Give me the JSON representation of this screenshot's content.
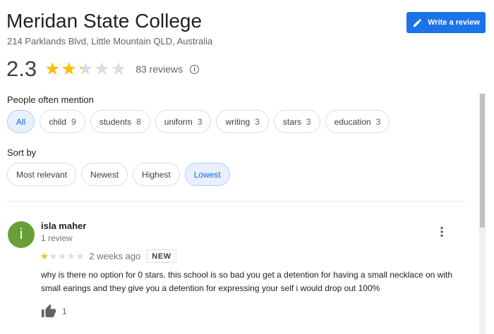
{
  "place": {
    "name": "Meridan State College",
    "address": "214 Parklands Blvd, Little Mountain QLD, Australia"
  },
  "write_review_label": "Write a review",
  "summary": {
    "rating": "2.3",
    "rating_value": 2.3,
    "review_count": "83 reviews"
  },
  "mentions": {
    "label": "People often mention",
    "chips": [
      {
        "label": "All",
        "count": ""
      },
      {
        "label": "child",
        "count": "9"
      },
      {
        "label": "students",
        "count": "8"
      },
      {
        "label": "uniform",
        "count": "3"
      },
      {
        "label": "writing",
        "count": "3"
      },
      {
        "label": "stars",
        "count": "3"
      },
      {
        "label": "education",
        "count": "3"
      }
    ]
  },
  "sort": {
    "label": "Sort by",
    "options": [
      "Most relevant",
      "Newest",
      "Highest",
      "Lowest"
    ],
    "selected": "Lowest"
  },
  "review": {
    "initial": "i",
    "name": "isla maher",
    "meta": "1 review",
    "stars": 1,
    "date": "2 weeks ago",
    "badge": "NEW",
    "text": "why is there no option for 0 stars. this school is so bad you get a detention for having a small necklace on with small earings and they give you a detention for expressing your self i would drop out 100%",
    "likes": "1"
  },
  "colors": {
    "accent": "#1a73e8",
    "star": "#fbbc04",
    "star_empty": "#dadce0",
    "avatar": "#689f38"
  }
}
